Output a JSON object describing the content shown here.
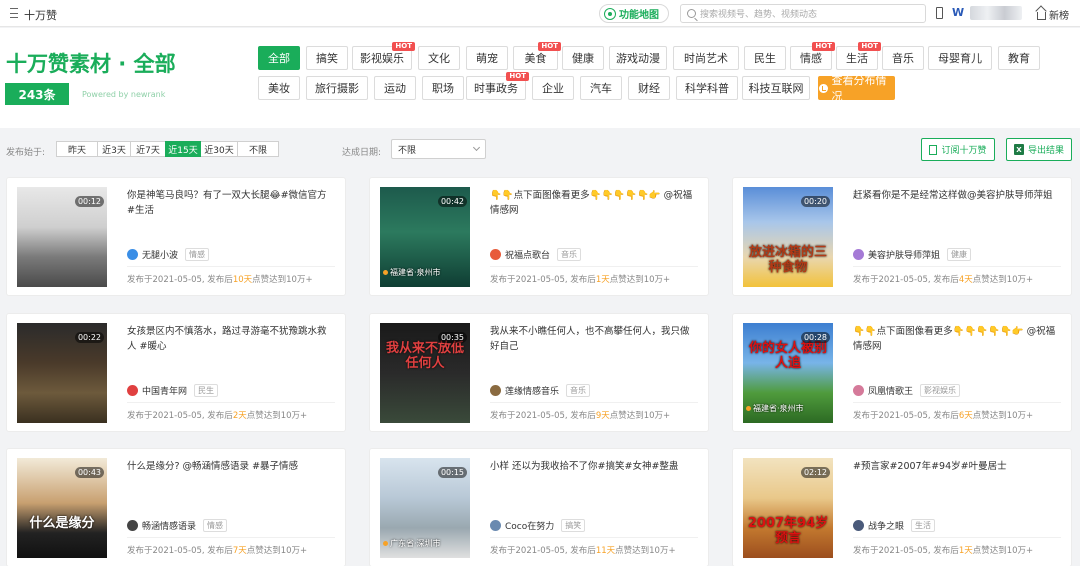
{
  "topbar": {
    "brand": "十万赞",
    "function_map": "功能地图",
    "search_placeholder": "搜索视频号、趋势、视频动态",
    "logo_letter": "W",
    "home_label": "新榜"
  },
  "page": {
    "title": "十万赞素材 · 全部",
    "count": "243条",
    "powered": "Powered by newrank"
  },
  "categories": [
    {
      "label": "全部",
      "active": true,
      "hot": false
    },
    {
      "label": "搞笑",
      "hot": false
    },
    {
      "label": "影视娱乐",
      "hot": true
    },
    {
      "label": "文化",
      "hot": false
    },
    {
      "label": "萌宠",
      "hot": false
    },
    {
      "label": "美食",
      "hot": true
    },
    {
      "label": "健康",
      "hot": false
    },
    {
      "label": "游戏动漫",
      "hot": false
    },
    {
      "label": "时尚艺术",
      "hot": false
    },
    {
      "label": "民生",
      "hot": false
    },
    {
      "label": "情感",
      "hot": true
    },
    {
      "label": "生活",
      "hot": true
    },
    {
      "label": "音乐",
      "hot": false
    },
    {
      "label": "母婴育儿",
      "hot": false
    },
    {
      "label": "教育",
      "hot": false
    },
    {
      "label": "美妆",
      "hot": false
    },
    {
      "label": "旅行摄影",
      "hot": false
    },
    {
      "label": "运动",
      "hot": false
    },
    {
      "label": "职场",
      "hot": false
    },
    {
      "label": "时事政务",
      "hot": true
    },
    {
      "label": "企业",
      "hot": false
    },
    {
      "label": "汽车",
      "hot": false
    },
    {
      "label": "财经",
      "hot": false
    },
    {
      "label": "科学科普",
      "hot": false
    },
    {
      "label": "科技互联网",
      "hot": false
    }
  ],
  "hot_label": "HOT",
  "distribution_button": "查看分布情况",
  "filters": {
    "publish_label": "发布始于:",
    "publish_options": [
      "昨天",
      "近3天",
      "近7天",
      "近15天",
      "近30天",
      "不限"
    ],
    "publish_active": "近15天",
    "reach_label": "达成日期:",
    "reach_value": "不限",
    "subscribe_button": "订阅十万赞",
    "export_button": "导出结果",
    "excel_icon_letter": "X"
  },
  "cards": [
    {
      "title": "你是神笔马良吗？有了一双大长腿😂#微信官方#生活",
      "duration": "00:12",
      "author": "无腿小波",
      "tag": "情感",
      "date": "发布于2021-05-05, 发布后",
      "days": "10天",
      "suffix": "点赞达到10万+",
      "overlay": "",
      "location": ""
    },
    {
      "title": "👇👇点下面图像看更多👇👇👇👇👇👉 @祝福情感网",
      "duration": "00:42",
      "author": "祝福点歌台",
      "tag": "音乐",
      "date": "发布于2021-05-05, 发布后",
      "days": "1天",
      "suffix": "点赞达到10万+",
      "overlay": "",
      "location": "福建省·泉州市"
    },
    {
      "title": "赶紧看你是不是经常这样做@美容护肤导师萍姐",
      "duration": "00:20",
      "author": "美容护肤导师萍姐",
      "tag": "健康",
      "date": "发布于2021-05-05, 发布后",
      "days": "4天",
      "suffix": "点赞达到10万+",
      "overlay": "放进冰箱的三种食物",
      "location": ""
    },
    {
      "title": "女孩景区内不慎落水，路过寻游毫不犹豫跳水救人 #暖心",
      "duration": "00:22",
      "author": "中国青年网",
      "tag": "民生",
      "date": "发布于2021-05-05, 发布后",
      "days": "2天",
      "suffix": "点赞达到10万+",
      "overlay": "",
      "location": ""
    },
    {
      "title": "我从来不小瞧任何人，也不高攀任何人，我只做好自己",
      "duration": "00:35",
      "author": "莲缘情感音乐",
      "tag": "音乐",
      "date": "发布于2021-05-05, 发布后",
      "days": "9天",
      "suffix": "点赞达到10万+",
      "overlay": "我从来不放低任何人",
      "location": ""
    },
    {
      "title": "👇👇点下面图像看更多👇👇👇👇👇👉 @祝福情感网",
      "duration": "00:28",
      "author": "凤凰情歌王",
      "tag": "影视娱乐",
      "date": "发布于2021-05-05, 发布后",
      "days": "6天",
      "suffix": "点赞达到10万+",
      "overlay": "你的女人被别人追",
      "location": "福建省·泉州市"
    },
    {
      "title": "什么是缘分? @畅涵情感语录 #暴子情感",
      "duration": "00:43",
      "author": "畅涵情感语录",
      "tag": "情感",
      "date": "发布于2021-05-05, 发布后",
      "days": "7天",
      "suffix": "点赞达到10万+",
      "overlay": "什么是缘分",
      "location": ""
    },
    {
      "title": "小样 还以为我收拾不了你#搞笑#女神#整蛊",
      "duration": "00:15",
      "author": "Coco在努力",
      "tag": "搞笑",
      "date": "发布于2021-05-05, 发布后",
      "days": "11天",
      "suffix": "点赞达到10万+",
      "overlay": "",
      "location": "广东省·深圳市"
    },
    {
      "title": "#预言家#2007年#94岁#叶曼居士",
      "duration": "02:12",
      "author": "战争之眼",
      "tag": "生活",
      "date": "发布于2021-05-05, 发布后",
      "days": "1天",
      "suffix": "点赞达到10万+",
      "overlay": "2007年94岁预言",
      "location": ""
    }
  ]
}
